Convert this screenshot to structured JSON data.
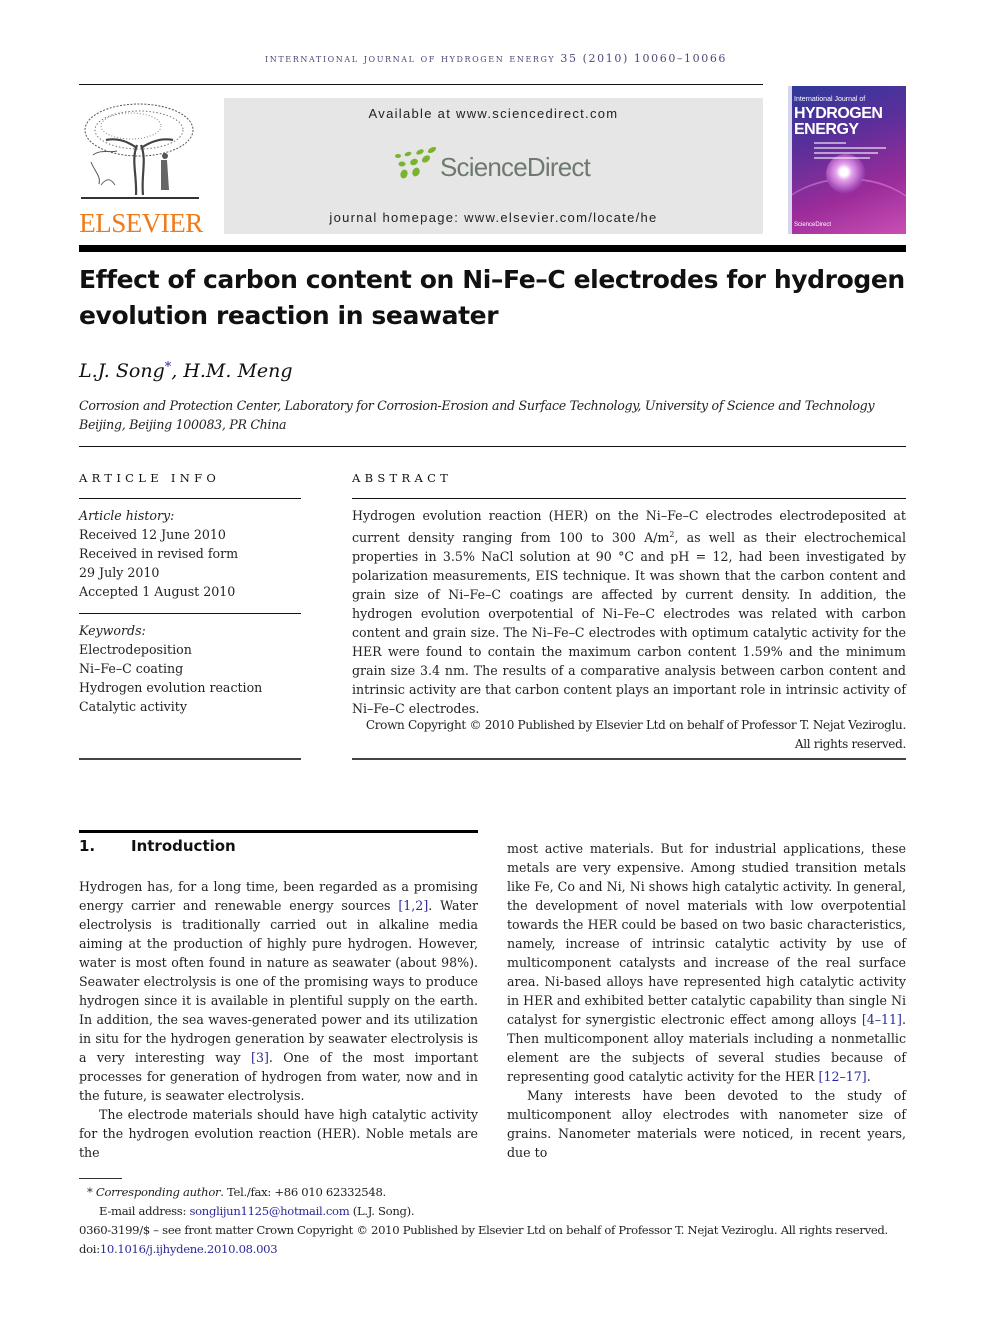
{
  "header": {
    "running_head": "International Journal of Hydrogen Energy 35 (2010) 10060–10066",
    "publisher_logo": "ELSEVIER",
    "available_at": "Available at www.sciencedirect.com",
    "sd_brand": "ScienceDirect",
    "journal_homepage": "journal homepage: www.elsevier.com/locate/he",
    "cover": {
      "line1": "International Journal of",
      "line2": "HYDROGEN",
      "line3": "ENERGY",
      "footer": "ScienceDirect"
    }
  },
  "article": {
    "title": "Effect of carbon content on Ni–Fe–C electrodes for hydrogen evolution reaction in seawater",
    "authors": {
      "author1": "L.J. Song",
      "author1_mark": "*",
      "separator": ", ",
      "author2": "H.M. Meng"
    },
    "affiliation": "Corrosion and Protection Center, Laboratory for Corrosion-Erosion and Surface Technology, University of Science and Technology Beijing, Beijing 100083, PR China"
  },
  "article_info": {
    "heading": "ARTICLE INFO",
    "history_label": "Article history:",
    "history": [
      "Received 12 June 2010",
      "Received in revised form",
      "29 July 2010",
      "Accepted 1 August 2010"
    ],
    "keywords_label": "Keywords:",
    "keywords": [
      "Electrodeposition",
      "Ni–Fe–C coating",
      "Hydrogen evolution reaction",
      "Catalytic activity"
    ]
  },
  "abstract": {
    "heading": "ABSTRACT",
    "text_part1": "Hydrogen evolution reaction (HER) on the Ni–Fe–C electrodes electrodeposited at current density ranging from 100 to 300 A/m",
    "sup": "2",
    "text_part2": ", as well as their electrochemical properties in 3.5% NaCl solution at 90 °C and pH = 12, had been investigated by polarization measurements, EIS technique. It was shown that the carbon content and grain size of Ni–Fe–C coatings are affected by current density. In addition, the hydrogen evolution overpotential of Ni–Fe–C electrodes was related with carbon content and grain size. The Ni–Fe–C electrodes with optimum catalytic activity for the HER were found to contain the maximum carbon content 1.59% and the minimum grain size 3.4 nm. The results of a comparative analysis between carbon content and intrinsic activity are that carbon content plays an important role in intrinsic activity of Ni–Fe–C electrodes.",
    "copyright": "Crown Copyright © 2010 Published by Elsevier Ltd on behalf of Professor T. Nejat Veziroglu. All rights reserved."
  },
  "introduction": {
    "number": "1.",
    "heading": "Introduction",
    "p1": [
      {
        "t": "Hydrogen has, for a long time, been regarded as a promising energy carrier and renewable energy sources "
      },
      {
        "ref": "[1,2]"
      },
      {
        "t": ". Water electrolysis is traditionally carried out in alkaline media aiming at the production of highly pure hydrogen. However, water is most often found in nature as seawater (about 98%). Seawater electrolysis is one of the promising ways to produce hydrogen since it is available in plentiful supply on the earth. In addition, the sea waves-generated power and its utilization in situ for the hydrogen generation by seawater electrolysis is a very interesting way "
      },
      {
        "ref": "[3]"
      },
      {
        "t": ". One of the most important processes for generation of hydrogen from water, now and in the future, is seawater electrolysis."
      }
    ],
    "p2": [
      {
        "t": "The electrode materials should have high catalytic activity for the hydrogen evolution reaction (HER). Noble metals are the most active materials. But for industrial applications, these metals are very expensive. Among studied transition metals like Fe, Co and Ni, Ni shows high catalytic activity. In general, the development of novel materials with low overpotential towards the HER could be based on two basic characteristics, namely, increase of intrinsic catalytic activity by use of multicomponent catalysts and increase of the real surface area. Ni-based alloys have represented high catalytic activity in HER and exhibited better catalytic capability than single Ni catalyst for synergistic electronic effect among alloys "
      },
      {
        "ref": "[4–11]"
      },
      {
        "t": ". Then multicomponent alloy materials including a nonmetallic element are the subjects of several studies because of representing good catalytic activity for the HER "
      },
      {
        "ref": "[12–17]"
      },
      {
        "t": "."
      }
    ],
    "p3": "Many interests have been devoted to the study of multicomponent alloy electrodes with nanometer size of grains. Nanometer materials were noticed, in recent years, due to"
  },
  "col1_split": "The electrode materials should have high catalytic activity for the hydrogen evolution reaction (HER). Noble metals are the",
  "col2_start": "most active materials. But for industrial applications, these metals are very expensive. Among studied transition metals like Fe, Co and Ni, Ni shows high catalytic activity. In general, the development of novel materials with low overpotential towards the HER could be based on two basic characteristics, namely, increase of intrinsic catalytic activity by use of multicomponent catalysts and increase of the real surface area. Ni-based alloys have represented high catalytic activity in HER and exhibited better catalytic capability than single Ni catalyst for synergistic electronic effect among alloys ",
  "col2_ref1": "[4–11]",
  "col2_mid": ". Then multicomponent alloy materials including a nonmetallic element are the subjects of several studies because of representing good catalytic activity for the HER ",
  "col2_ref2": "[12–17]",
  "col2_end": ".",
  "footnotes": {
    "star": "*",
    "corresponding_label": "Corresponding author",
    "tel": ". Tel./fax: +86 010 62332548.",
    "email_label": "E-mail address: ",
    "email": "songlijun1125@hotmail.com",
    "email_suffix": " (L.J. Song).",
    "issn_line": "0360-3199/$ – see front matter Crown Copyright © 2010 Published by Elsevier Ltd on behalf of Professor T. Nejat Veziroglu. All rights reserved.",
    "doi_label": "doi:",
    "doi": "10.1016/j.ijhydene.2010.08.003"
  }
}
